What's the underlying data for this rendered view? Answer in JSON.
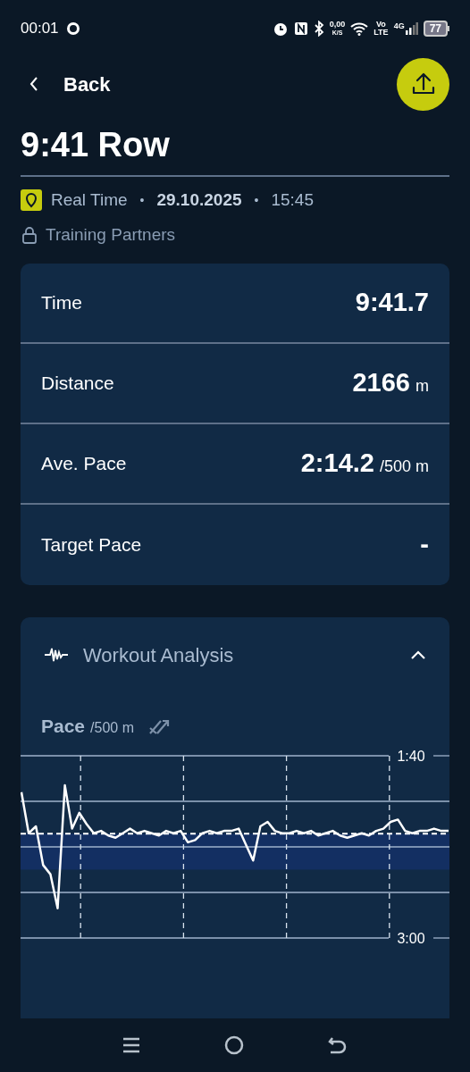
{
  "status_bar": {
    "time": "00:01",
    "net_speed": "0,00",
    "net_unit": "K/S",
    "volte_top": "Vo",
    "volte_bottom": "LTE",
    "network": "4G",
    "battery": "77"
  },
  "header": {
    "back_label": "Back"
  },
  "title": "9:41 Row",
  "meta": {
    "mode": "Real Time",
    "separator_1": "•",
    "date": "29.10.2025",
    "separator_2": "•",
    "time": "15:45",
    "privacy": "Training Partners"
  },
  "stats": [
    {
      "label": "Time",
      "value": "9:41.7"
    },
    {
      "label": "Distance",
      "value": "2166",
      "unit": "m"
    },
    {
      "label": "Ave. Pace",
      "value": "2:14.2",
      "unit": "/500 m"
    },
    {
      "label": "Target Pace",
      "value": "-"
    }
  ],
  "analysis": {
    "title": "Workout Analysis",
    "expanded": true,
    "graph": {
      "title": "Pace",
      "unit": "/500 m",
      "axis_labels": [
        "1:40",
        "3:00"
      ]
    }
  }
}
